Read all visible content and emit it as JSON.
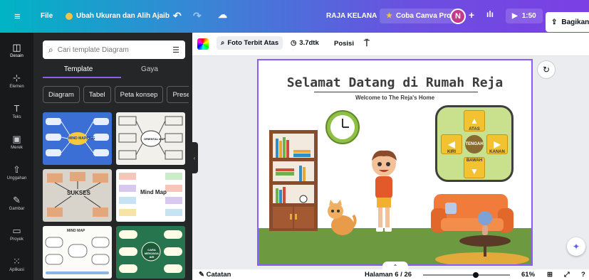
{
  "topbar": {
    "menu_icon": "menu-icon",
    "file_label": "File",
    "resize_label": "Ubah Ukuran dan Alih Ajaib",
    "owner_name": "RAJA KELANA",
    "try_pro_label": "Coba Canva Pro",
    "avatar_letter": "N",
    "timer_label": "1:50",
    "share_label": "Bagikan"
  },
  "rail": {
    "items": [
      {
        "label": "Desain",
        "icon": "design-icon"
      },
      {
        "label": "Elemen",
        "icon": "elements-icon"
      },
      {
        "label": "Teks",
        "icon": "text-icon"
      },
      {
        "label": "Merek",
        "icon": "brand-icon"
      },
      {
        "label": "Unggahan",
        "icon": "upload-icon"
      },
      {
        "label": "Gambar",
        "icon": "draw-icon"
      },
      {
        "label": "Proyek",
        "icon": "folder-icon"
      },
      {
        "label": "Aplikasi",
        "icon": "apps-icon"
      }
    ]
  },
  "panel": {
    "search_placeholder": "Cari template Diagram",
    "tabs": [
      "Template",
      "Gaya"
    ],
    "chips": [
      "Diagram",
      "Tabel",
      "Peta konsep",
      "Prese"
    ],
    "thumbs": [
      {
        "title": "MIND MAPPING",
        "bg": "#3b6fd6"
      },
      {
        "title": "ORIENTAL MAP",
        "bg": "#f1f0ea"
      },
      {
        "title": "SUKSES",
        "bg": "#d8d4cc"
      },
      {
        "title": "Mind Map",
        "bg": "#ffffff"
      },
      {
        "title": "MIND MAP",
        "bg": "#fbfbf7"
      },
      {
        "title": "CARA MENJAGA AIR",
        "bg": "#27754e"
      }
    ]
  },
  "toolbar": {
    "photo_label": "Foto Terbit Atas",
    "duration_label": "3.7dtk",
    "position_label": "Posisi"
  },
  "canvas": {
    "title": "Selamat Datang di Rumah Reja",
    "subtitle": "Welcome to The Reja's Home",
    "nav": {
      "up": "ATAS",
      "center": "TENGAH",
      "left": "KIRI",
      "right": "KANAN",
      "down": "BAWAH"
    }
  },
  "statusbar": {
    "notes_label": "Catatan",
    "page_label": "Halaman 6 / 26",
    "zoom_label": "61%",
    "zoom_value": 0.61
  },
  "colors": {
    "accent": "#8b5cf6",
    "sidebar": "#18191b",
    "panel": "#252627"
  }
}
